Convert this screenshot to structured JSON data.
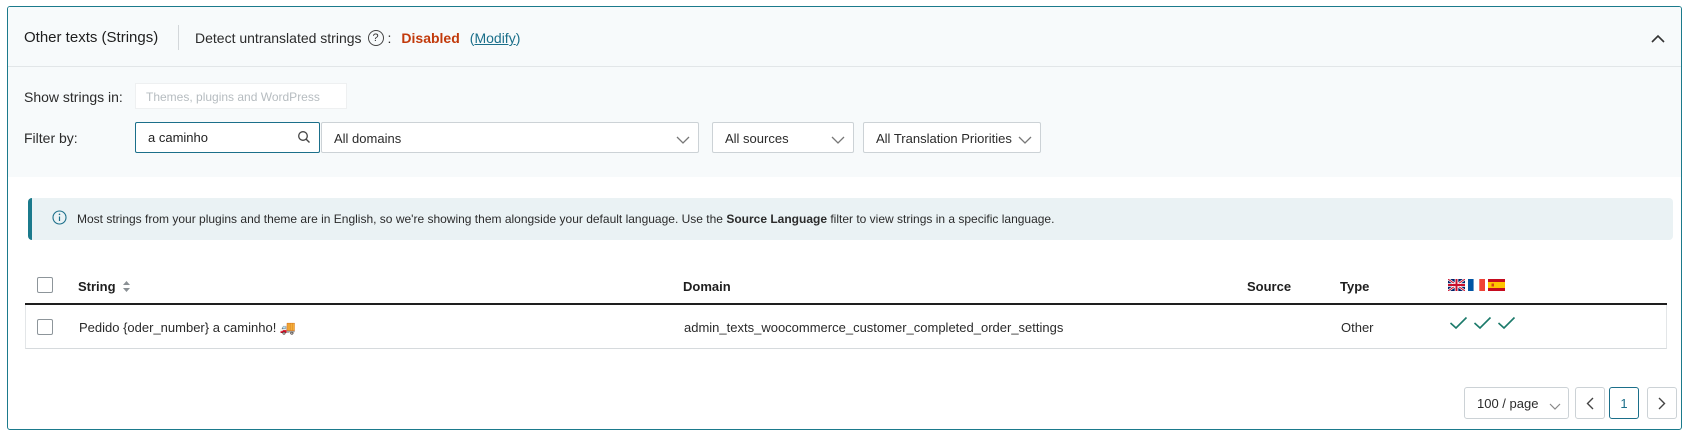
{
  "header": {
    "title": "Other texts (Strings)",
    "detect_label": "Detect untranslated strings",
    "help_icon_glyph": "?",
    "colon": ":",
    "status": "Disabled",
    "modify_open": "(",
    "modify_label": "Modify",
    "modify_close": ")"
  },
  "filters": {
    "show_label": "Show strings in:",
    "show_placeholder": "Themes, plugins and WordPress",
    "filter_label": "Filter by:",
    "search_value": "a caminho",
    "domain_select": "All domains",
    "source_select": "All sources",
    "priority_select": "All Translation Priorities"
  },
  "notice": {
    "text_before": "Most strings from your plugins and theme are in English, so we're showing them alongside your default language. Use the ",
    "text_bold": "Source Language",
    "text_after": " filter to view strings in a specific language."
  },
  "table": {
    "headers": {
      "string": "String",
      "domain": "Domain",
      "source": "Source",
      "type": "Type"
    },
    "language_flags": [
      "flag-en-icon",
      "flag-fr-icon",
      "flag-es-icon"
    ],
    "rows": [
      {
        "string": "Pedido {oder_number} a caminho! 🚚",
        "domain": "admin_texts_woocommerce_customer_completed_order_settings",
        "source": "",
        "type": "Other",
        "translations": [
          "✓",
          "✓",
          "✓"
        ]
      }
    ]
  },
  "pagination": {
    "per_page": "100 / page",
    "current_page": "1"
  },
  "colors": {
    "accent": "#1b6f8a",
    "status_disabled": "#c23a0b",
    "check": "#1b7a6a"
  }
}
